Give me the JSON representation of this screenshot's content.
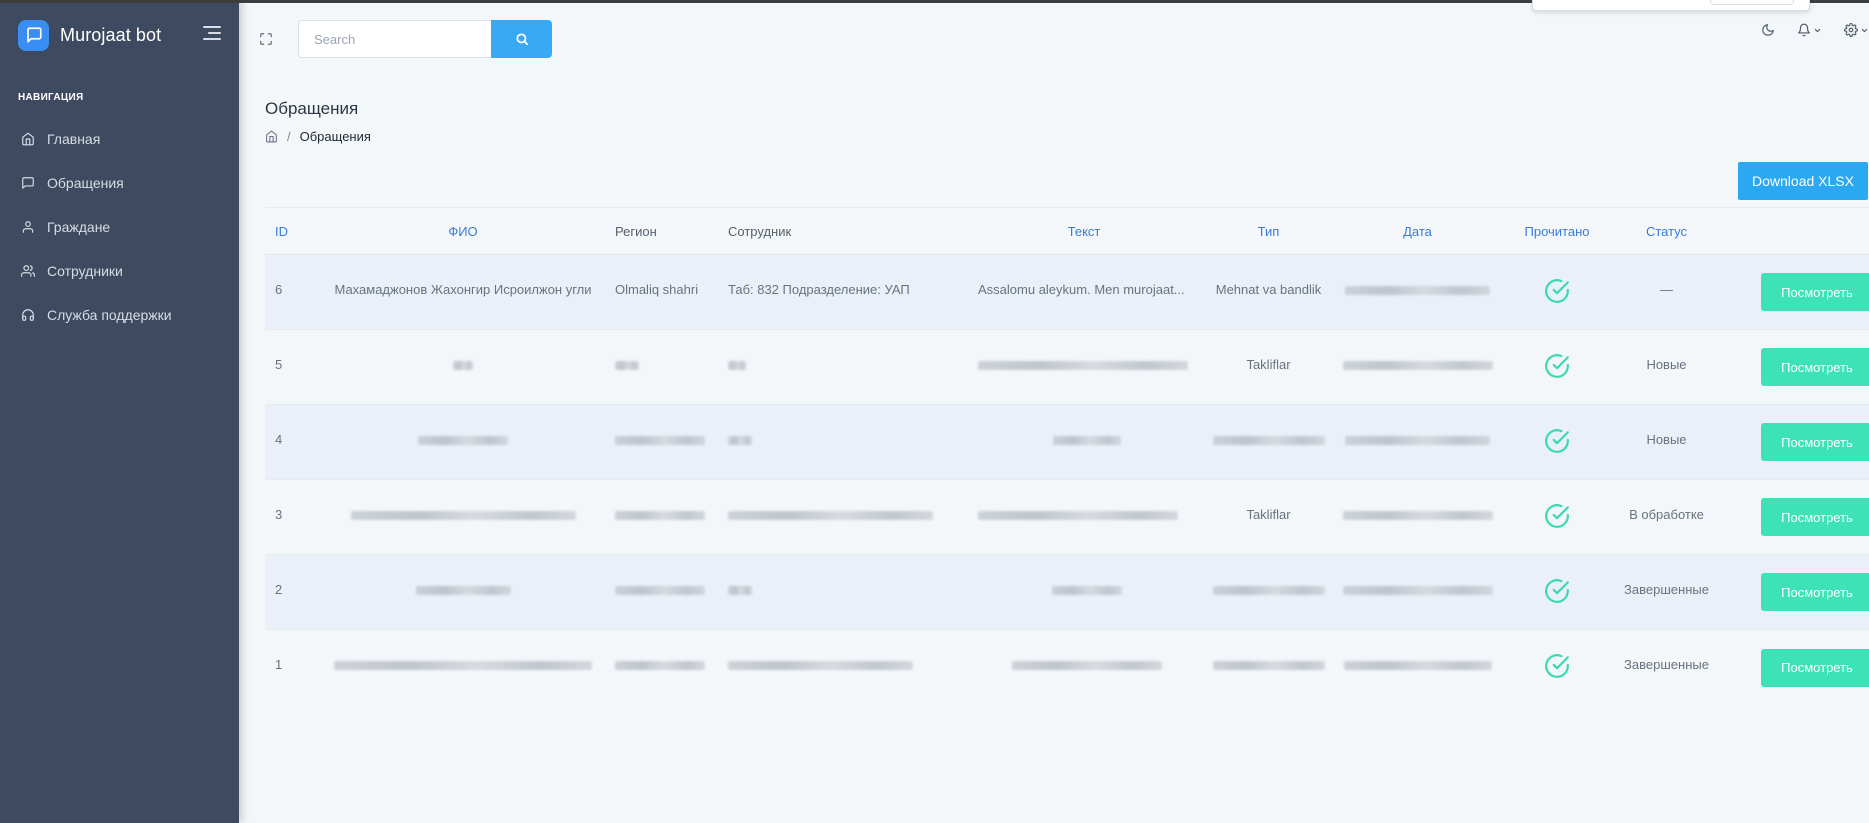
{
  "brand": {
    "name": "Murojaat bot"
  },
  "sidebar": {
    "heading": "НАВИГАЦИЯ",
    "items": [
      {
        "label": "Главная",
        "icon": "home-icon"
      },
      {
        "label": "Обращения",
        "icon": "message-square-icon"
      },
      {
        "label": "Граждане",
        "icon": "user-icon"
      },
      {
        "label": "Сотрудники",
        "icon": "users-icon"
      },
      {
        "label": "Служба поддержки",
        "icon": "headphones-icon"
      }
    ]
  },
  "topbar": {
    "search_placeholder": "Search",
    "icons": [
      "fullscreen-icon",
      "search-icon",
      "moon-icon",
      "bell-icon",
      "settings-icon"
    ]
  },
  "page": {
    "title": "Обращения",
    "breadcrumb_sep": "/",
    "breadcrumb_current": "Обращения",
    "download_label": "Download XLSX"
  },
  "table": {
    "headers": {
      "id": "ID",
      "fio": "ФИО",
      "region": "Регион",
      "employee": "Сотрудник",
      "text": "Текст",
      "type": "Тип",
      "date": "Дата",
      "read": "Прочитано",
      "status": "Статус"
    },
    "view_label": "Посмотреть",
    "rows": [
      {
        "id": "6",
        "fio": "Махамаджонов Жахонгир Исроилжон угли",
        "region": "Olmaliq shahri",
        "employee": "Таб: 832 Подразделение: УАП",
        "text": "Assalomu aleykum. Men murojaat...",
        "type": "Mehnat va bandlik",
        "date": "",
        "status": "—"
      },
      {
        "id": "5",
        "fio": "",
        "region": "",
        "employee": "",
        "text": "",
        "type": "Takliflar",
        "date": "",
        "status": "Новые"
      },
      {
        "id": "4",
        "fio": "",
        "region": "",
        "employee": "",
        "text": "",
        "type": "",
        "date": "",
        "status": "Новые"
      },
      {
        "id": "3",
        "fio": "",
        "region": "",
        "employee": "",
        "text": "",
        "type": "Takliflar",
        "date": "",
        "status": "В обработке"
      },
      {
        "id": "2",
        "fio": "",
        "region": "",
        "employee": "",
        "text": "",
        "type": "",
        "date": "",
        "status": "Завершенные"
      },
      {
        "id": "1",
        "fio": "",
        "region": "",
        "employee": "",
        "text": "",
        "type": "",
        "date": "",
        "status": "Завершенные"
      }
    ]
  },
  "colors": {
    "sidebar_bg": "#3d4a5f",
    "brand_logo": "#3a8df2",
    "search_button": "#3aa9f5",
    "download_button": "#2aa8f2",
    "view_button": "#3de2b6",
    "check": "#3ad9b0",
    "header_link": "#3b7bd8"
  }
}
